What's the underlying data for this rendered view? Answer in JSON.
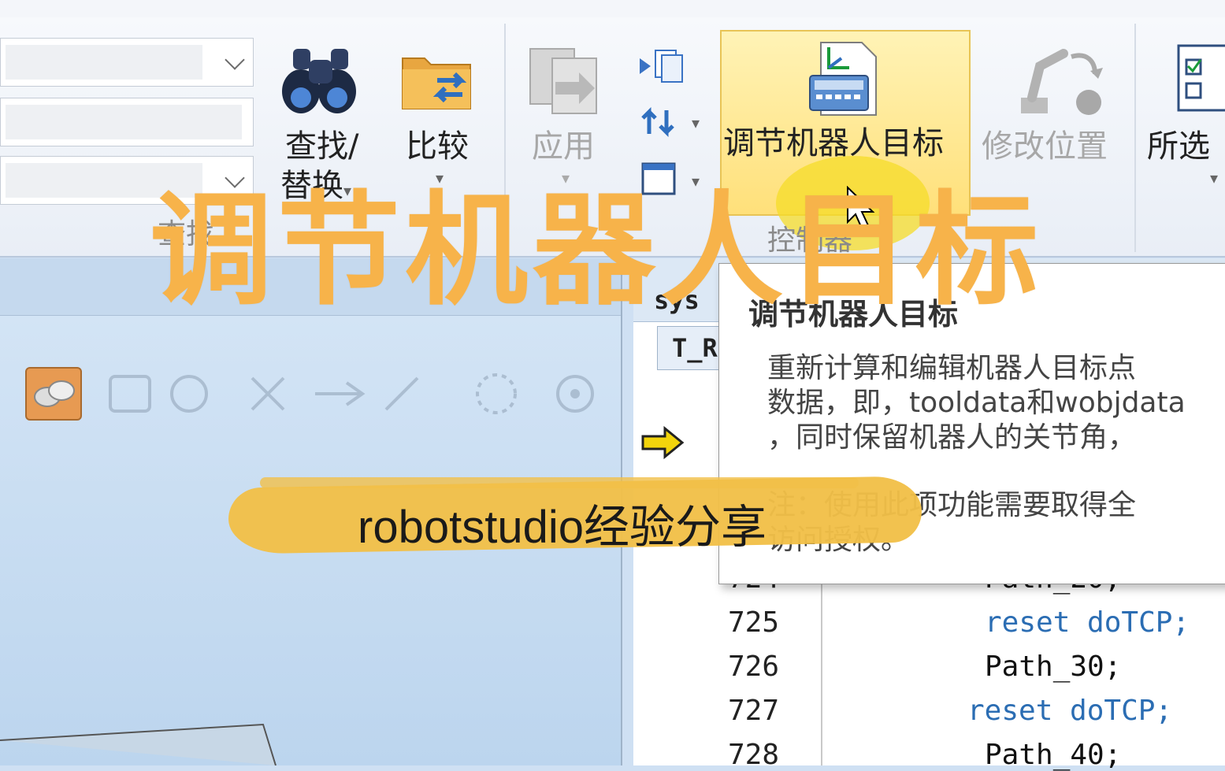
{
  "ribbon": {
    "find_replace_line1": "查找/",
    "find_replace_line2": "替换",
    "compare_label": "比较",
    "apply_label": "应用",
    "adjust_robot_targets_label": "调节机器人目标",
    "modify_position_label": "修改位置",
    "selected_label": "所选",
    "group_find_label": "查找",
    "group_control_label": "控制器"
  },
  "editor": {
    "tab_label": "T_R",
    "tab_partial": "sys",
    "lines": [
      {
        "no": "724",
        "indent": "      ",
        "text": "Path_20;"
      },
      {
        "no": "725",
        "indent": "      ",
        "text": "reset doTCP;"
      },
      {
        "no": "726",
        "indent": "      ",
        "text": "Path_30;"
      },
      {
        "no": "727",
        "indent": "     ",
        "text": "reset doTCP;"
      },
      {
        "no": "728",
        "indent": "      ",
        "text": "Path_40;"
      }
    ]
  },
  "tooltip": {
    "title": "调节机器人目标",
    "body_line1": "重新计算和编辑机器人目标点",
    "body_line2": "数据，即，tooldata和wobjdata",
    "body_line3": "，同时保留机器人的关节角，",
    "body_line4": "注：使用此项功能需要取得全",
    "body_line5": "访问授权。"
  },
  "overlay": {
    "big_title": "调节机器人目标",
    "subtitle": "robotstudio经验分享"
  },
  "colors": {
    "highlight_button": "#ffe07a",
    "overlay_title": "#f7b34a",
    "brush": "#f1bf48",
    "keyword": "#2b6db3"
  }
}
